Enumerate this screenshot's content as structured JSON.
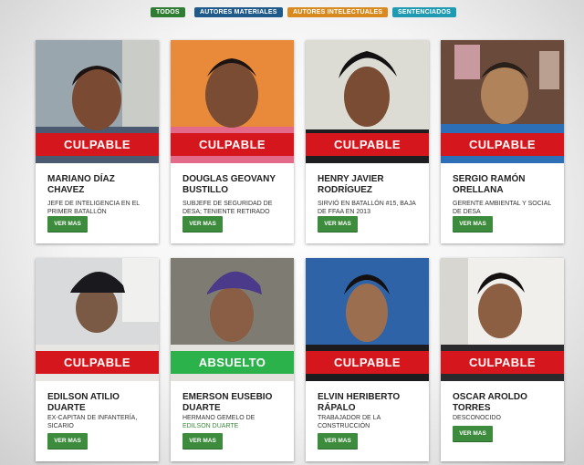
{
  "filters": [
    {
      "label": "TODOS",
      "color": "#2f7d32"
    },
    {
      "label": "AUTORES MATERIALES",
      "color": "#1f5a8a"
    },
    {
      "label": "AUTORES INTELECTUALES",
      "color": "#d98a1e"
    },
    {
      "label": "SENTENCIADOS",
      "color": "#1e9bb3"
    }
  ],
  "colors": {
    "guilty": "#d6161d",
    "acquitted": "#2bb24a",
    "button": "#3d8b3d"
  },
  "cards": [
    {
      "verdict": "CULPABLE",
      "name": "MARIANO DÍAZ CHAVEZ",
      "desc": "JEFE DE INTELIGENCIA EN EL PRIMER BATALLÓN",
      "desc_link": "",
      "button": "VER MAS"
    },
    {
      "verdict": "CULPABLE",
      "name": "DOUGLAS GEOVANY BUSTILLO",
      "desc": "SUBJEFE DE SEGURIDAD DE DESA; TENIENTE RETIRADO",
      "desc_link": "",
      "button": "VER MAS"
    },
    {
      "verdict": "CULPABLE",
      "name": "HENRY JAVIER RODRÍGUEZ",
      "desc": "SIRVIÓ EN BATALLÓN #15, BAJA DE FFAA EN 2013",
      "desc_link": "",
      "button": "VER MAS"
    },
    {
      "verdict": "CULPABLE",
      "name": "SERGIO RAMÓN ORELLANA",
      "desc": "GERENTE AMBIENTAL Y SOCIAL DE DESA",
      "desc_link": "",
      "button": "VER MAS"
    },
    {
      "verdict": "CULPABLE",
      "name": "EDILSON ATILIO DUARTE",
      "desc": "EX-CAPITAN DE INFANTERÍA, SICARIO",
      "desc_link": "",
      "button": "VER MAS"
    },
    {
      "verdict": "ABSUELTO",
      "name": "EMERSON EUSEBIO DUARTE",
      "desc": "HERMANO GEMELO DE",
      "desc_link": "EDILSON DUARTE",
      "button": "VER MAS"
    },
    {
      "verdict": "CULPABLE",
      "name": "ELVIN HERIBERTO RÁPALO",
      "desc": "TRABAJADOR DE LA CONSTRUCCIÓN",
      "desc_link": "",
      "button": "VER MAS"
    },
    {
      "verdict": "CULPABLE",
      "name": "OSCAR AROLDO TORRES",
      "desc": "DESCONOCIDO",
      "desc_link": "",
      "button": "VER MAS"
    }
  ]
}
